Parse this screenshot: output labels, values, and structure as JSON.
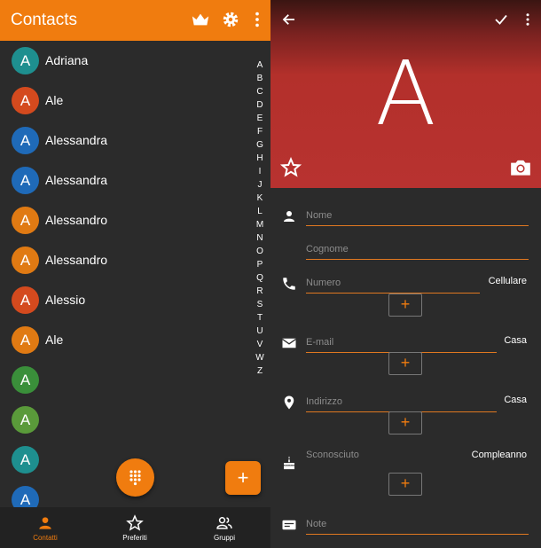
{
  "left": {
    "title": "Contacts",
    "contacts": [
      {
        "letter": "A",
        "name": "Adriana",
        "color": "#1e8f8f"
      },
      {
        "letter": "A",
        "name": "Ale",
        "color": "#d44a1e"
      },
      {
        "letter": "A",
        "name": "Alessandra",
        "color": "#1f6ab8"
      },
      {
        "letter": "A",
        "name": "Alessandra",
        "color": "#1f6ab8"
      },
      {
        "letter": "A",
        "name": "Alessandro",
        "color": "#e07a13"
      },
      {
        "letter": "A",
        "name": "Alessandro",
        "color": "#e07a13"
      },
      {
        "letter": "A",
        "name": "Alessio",
        "color": "#d44a1e"
      },
      {
        "letter": "A",
        "name": "Ale",
        "color": "#e07a13"
      },
      {
        "letter": "A",
        "name": "",
        "color": "#3a8f3a"
      },
      {
        "letter": "A",
        "name": "",
        "color": "#5a9a3a"
      },
      {
        "letter": "A",
        "name": "",
        "color": "#1e8f8f"
      },
      {
        "letter": "A",
        "name": "",
        "color": "#1f6ab8"
      }
    ],
    "alphabet": [
      "A",
      "B",
      "C",
      "D",
      "E",
      "F",
      "G",
      "H",
      "I",
      "J",
      "K",
      "L",
      "M",
      "N",
      "O",
      "P",
      "Q",
      "R",
      "S",
      "T",
      "U",
      "V",
      "W",
      "Z"
    ],
    "fab_add": "+",
    "nav": [
      {
        "label": "Contatti",
        "icon": "person-icon",
        "active": true
      },
      {
        "label": "Preferiti",
        "icon": "star-icon",
        "active": false
      },
      {
        "label": "Gruppi",
        "icon": "group-icon",
        "active": false
      }
    ]
  },
  "right": {
    "avatar_letter": "A",
    "fields": {
      "nome": "Nome",
      "cognome": "Cognome",
      "numero": "Numero",
      "numero_type": "Cellulare",
      "email": "E-mail",
      "email_type": "Casa",
      "indirizzo": "Indirizzo",
      "indirizzo_type": "Casa",
      "compleanno_value": "Sconosciuto",
      "compleanno_type": "Compleanno",
      "note": "Note"
    },
    "plus": "+"
  },
  "colors": {
    "accent": "#f07c0f",
    "header_red": "#b83230",
    "background": "#2b2b2b"
  }
}
